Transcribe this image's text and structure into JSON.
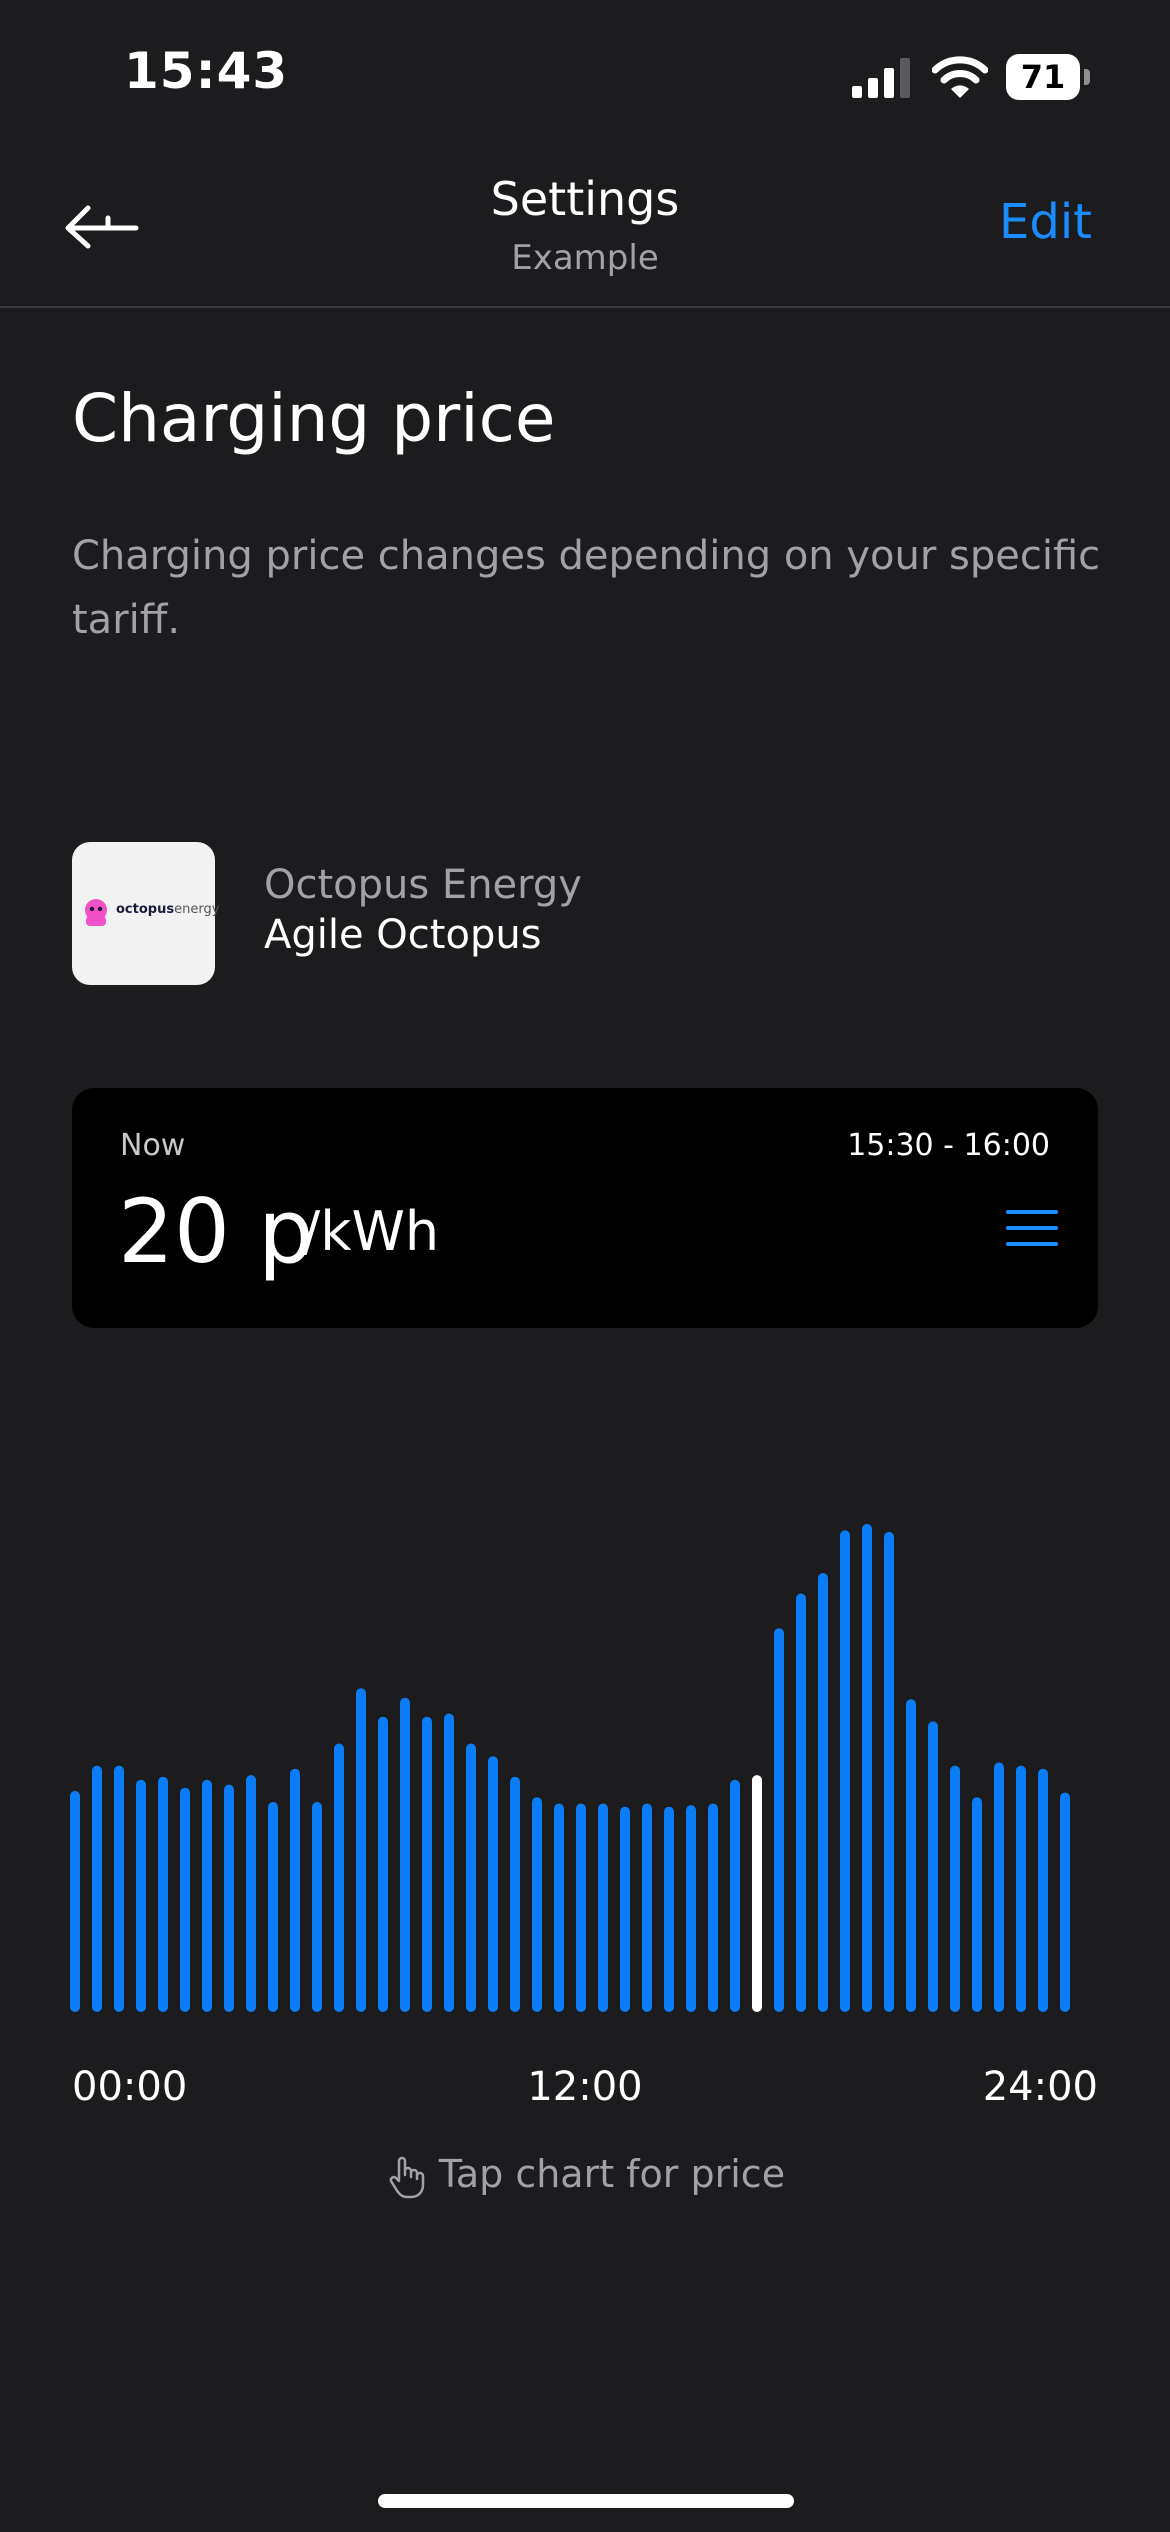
{
  "status_bar": {
    "time": "15:43",
    "battery_percent": "71",
    "icons": [
      "signal-icon",
      "wifi-icon",
      "battery-icon"
    ]
  },
  "nav": {
    "title": "Settings",
    "subtitle": "Example",
    "edit_label": "Edit",
    "back_icon": "back-arrow-icon"
  },
  "page": {
    "title": "Charging price",
    "description": "Charging price changes depending on your specific tariff."
  },
  "provider": {
    "logo_text_bold": "octopus",
    "logo_text_light": "energy",
    "name": "Octopus Energy",
    "tariff": "Agile Octopus"
  },
  "price_card": {
    "now_label": "Now",
    "time_range": "15:30 - 16:00",
    "price": "20 p",
    "unit": "/kWh",
    "menu_icon": "list-icon"
  },
  "chart_data": {
    "type": "bar",
    "xlabel": "",
    "ylabel": "",
    "x_tick_labels": [
      "00:00",
      "12:00",
      "24:00"
    ],
    "current_index": 31,
    "values": [
      14.0,
      15.6,
      15.6,
      14.7,
      14.9,
      14.2,
      14.7,
      14.4,
      15.0,
      13.3,
      15.4,
      13.3,
      17.0,
      20.5,
      18.7,
      19.9,
      18.7,
      18.9,
      17.0,
      16.2,
      14.9,
      13.6,
      13.2,
      13.2,
      13.2,
      13.0,
      13.2,
      13.0,
      13.1,
      13.2,
      14.7,
      15.0,
      24.3,
      26.5,
      27.8,
      30.5,
      30.9,
      30.4,
      19.8,
      18.4,
      15.6,
      13.6,
      15.8,
      15.6,
      15.4,
      13.9
    ],
    "colors": {
      "bar": "#0a7cf5",
      "current": "#ffffff"
    }
  },
  "hint": {
    "text": "Tap chart for price",
    "icon": "hand-pointer-icon"
  },
  "colors": {
    "background": "#1c1c1e",
    "card": "#000000",
    "accent": "#1a8cff"
  }
}
